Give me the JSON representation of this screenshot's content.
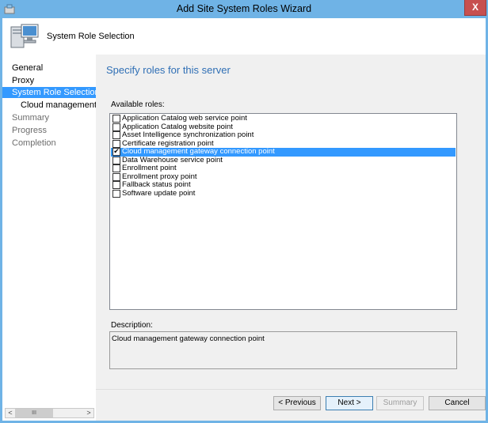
{
  "window": {
    "title": "Add Site System Roles Wizard",
    "close_label": "X"
  },
  "header": {
    "title": "System Role Selection"
  },
  "nav": {
    "items": [
      {
        "label": "General",
        "state": "normal"
      },
      {
        "label": "Proxy",
        "state": "normal"
      },
      {
        "label": "System Role Selection",
        "state": "selected"
      },
      {
        "label": "Cloud management gate",
        "state": "sub"
      },
      {
        "label": "Summary",
        "state": "dim"
      },
      {
        "label": "Progress",
        "state": "dim"
      },
      {
        "label": "Completion",
        "state": "dim"
      }
    ],
    "scroll_thumb": "III",
    "scroll_left": "<",
    "scroll_right": ">"
  },
  "main": {
    "heading": "Specify roles for this server",
    "roles_label": "Available roles:",
    "roles": [
      {
        "label": "Application Catalog web service point",
        "checked": false,
        "selected": false
      },
      {
        "label": "Application Catalog website point",
        "checked": false,
        "selected": false
      },
      {
        "label": "Asset Intelligence synchronization point",
        "checked": false,
        "selected": false
      },
      {
        "label": "Certificate registration point",
        "checked": false,
        "selected": false
      },
      {
        "label": "Cloud management gateway connection point",
        "checked": true,
        "selected": true
      },
      {
        "label": "Data Warehouse service point",
        "checked": false,
        "selected": false
      },
      {
        "label": "Enrollment point",
        "checked": false,
        "selected": false
      },
      {
        "label": "Enrollment proxy point",
        "checked": false,
        "selected": false
      },
      {
        "label": "Fallback status point",
        "checked": false,
        "selected": false
      },
      {
        "label": "Software update point",
        "checked": false,
        "selected": false
      }
    ],
    "description_label": "Description:",
    "description": "Cloud management gateway connection point"
  },
  "buttons": {
    "previous": "< Previous",
    "next": "Next >",
    "summary": "Summary",
    "cancel": "Cancel"
  },
  "colors": {
    "accent": "#3399ff",
    "heading": "#2f6fb5",
    "titlebar": "#6fb3e6",
    "close": "#c75050"
  }
}
